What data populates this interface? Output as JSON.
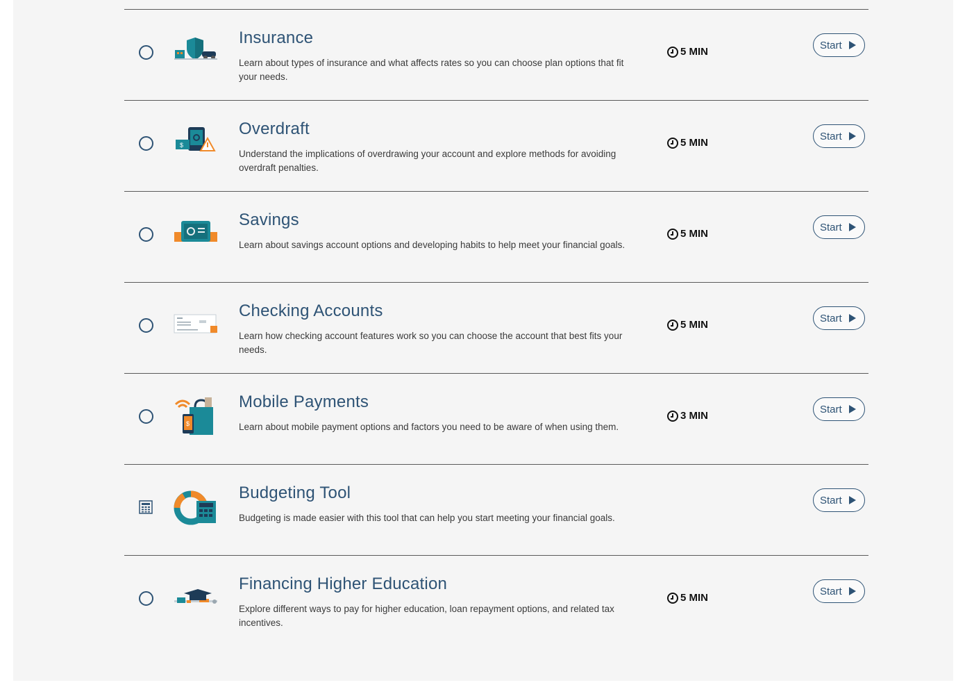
{
  "modules": [
    {
      "title": "Insurance",
      "description": "Learn about types of insurance and what affects rates so you can choose plan options that fit your needs.",
      "duration": "5 MIN",
      "button": "Start",
      "icon": "insurance-icon",
      "selector": "radio"
    },
    {
      "title": "Overdraft",
      "description": "Understand the implications of overdrawing your account and explore methods for avoiding overdraft penalties.",
      "duration": "5 MIN",
      "button": "Start",
      "icon": "overdraft-icon",
      "selector": "radio"
    },
    {
      "title": "Savings",
      "description": "Learn about savings account options and developing habits to help meet your financial goals.",
      "duration": "5 MIN",
      "button": "Start",
      "icon": "savings-safe-icon",
      "selector": "radio"
    },
    {
      "title": "Checking Accounts",
      "description": "Learn how checking account features work so you can choose the account that best fits your needs.",
      "duration": "5 MIN",
      "button": "Start",
      "icon": "check-icon",
      "selector": "radio"
    },
    {
      "title": "Mobile Payments",
      "description": "Learn about mobile payment options and factors you need to be aware of when using them.",
      "duration": "3 MIN",
      "button": "Start",
      "icon": "mobile-payments-icon",
      "selector": "radio"
    },
    {
      "title": "Budgeting Tool",
      "description": "Budgeting is made easier with this tool that can help you start meeting your financial goals.",
      "duration": "",
      "button": "Start",
      "icon": "budget-calculator-icon",
      "selector": "calculator"
    },
    {
      "title": "Financing Higher Education",
      "description": "Explore different ways to pay for higher education, loan repayment options, and related tax incentives.",
      "duration": "5 MIN",
      "button": "Start",
      "icon": "graduation-cap-icon",
      "selector": "radio"
    }
  ],
  "colors": {
    "title": "#2e5375",
    "teal": "#1b8a98",
    "orange": "#f08a2a",
    "navy": "#1d3b57",
    "divider": "#5a5a5a",
    "panel": "#f5f5f5"
  }
}
